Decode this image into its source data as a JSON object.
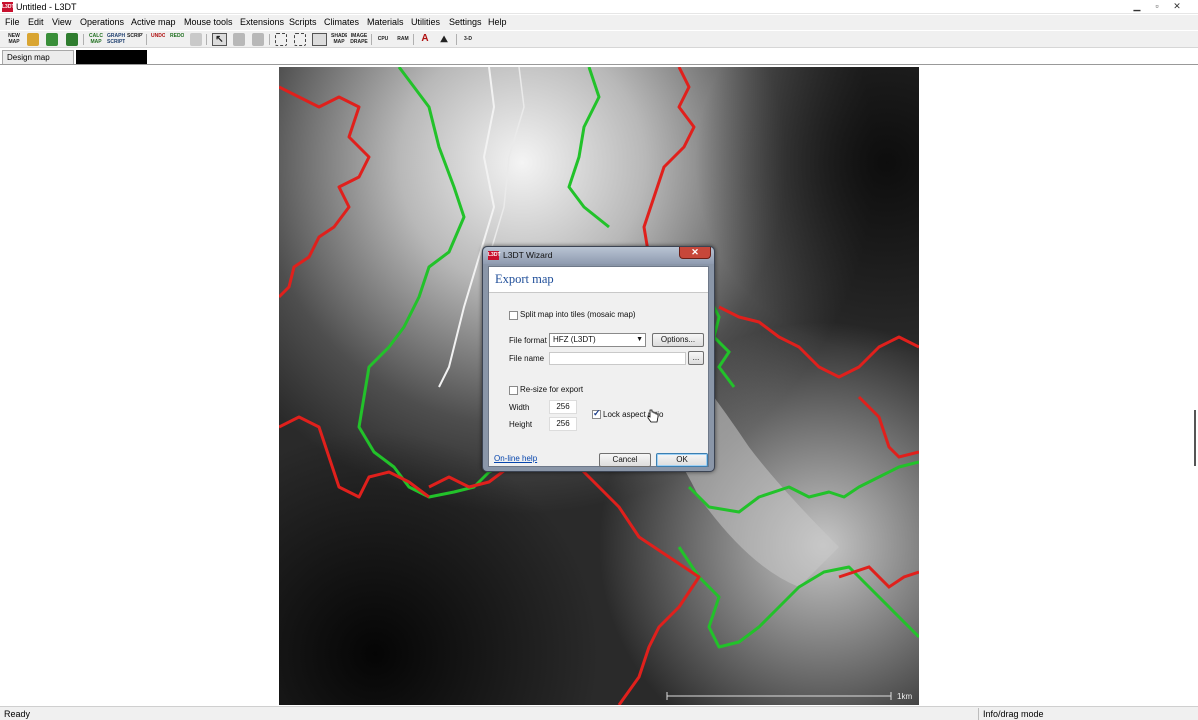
{
  "window": {
    "title": "Untitled - L3DT",
    "icon_text": "L3DT"
  },
  "menu": [
    "File",
    "Edit",
    "View",
    "Operations",
    "Active map",
    "Mouse tools",
    "Extensions",
    "Scripts",
    "Climates",
    "Materials",
    "Utilities",
    "Settings",
    "Help"
  ],
  "toolbar": {
    "new": "NEW MAP",
    "calc": "CALC MAP",
    "graph": "GRAPH SCRIPT",
    "script": "SCRIPT",
    "undo": "UNDO",
    "redo": "REDO",
    "shade": "SHADE MAP",
    "image": "IMAGE DRAPE",
    "cpu": "CPU",
    "ram": "RAM",
    "threed": "3-D"
  },
  "tabs": {
    "design_map": "Design map"
  },
  "map": {
    "scale_label": "1km"
  },
  "status": {
    "left": "Ready",
    "right": "Info/drag mode"
  },
  "dialog": {
    "title": "L3DT Wizard",
    "heading": "Export map",
    "split_label": "Split map into tiles (mosaic map)",
    "split_checked": false,
    "file_format_label": "File format",
    "file_format_value": "HFZ (L3DT)",
    "options_button": "Options...",
    "file_name_label": "File name",
    "file_name_value": "",
    "browse_button": "...",
    "resize_label": "Re-size for export",
    "resize_checked": false,
    "width_label": "Width",
    "width_value": "256",
    "height_label": "Height",
    "height_value": "256",
    "lock_label": "Lock aspect ratio",
    "lock_checked": true,
    "online_help": "On-line help",
    "cancel_button": "Cancel",
    "ok_button": "OK"
  },
  "colors": {
    "contour_red": "#e0201c",
    "contour_green": "#22c22a",
    "river": "#f2f2f2",
    "dialog_heading": "#1f4e99"
  }
}
